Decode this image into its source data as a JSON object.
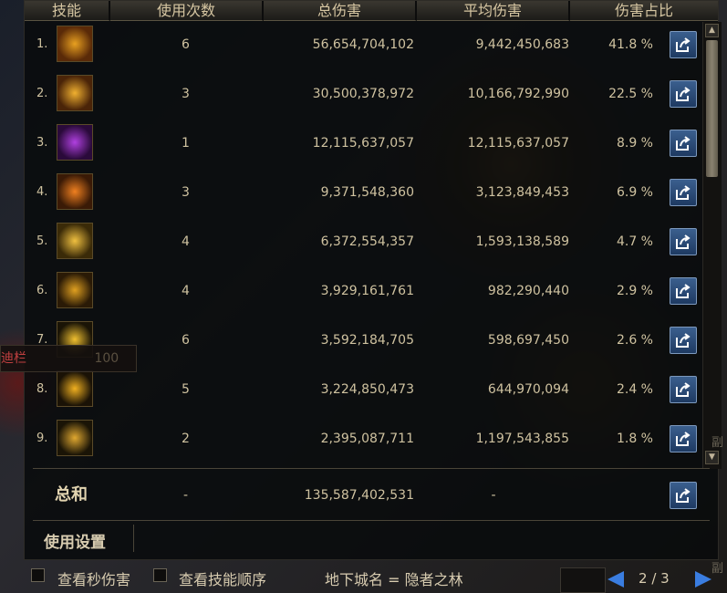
{
  "headers": [
    "技能",
    "使用次数",
    "总伤害",
    "平均伤害",
    "伤害占比"
  ],
  "rows": [
    {
      "rank": "1.",
      "count": "6",
      "total": "56,654,704,102",
      "avg": "9,442,450,683",
      "pct": "41.8 %",
      "icon": "skill-1-icon",
      "colors": [
        "#e8a020",
        "#5a2a08"
      ]
    },
    {
      "rank": "2.",
      "count": "3",
      "total": "30,500,378,972",
      "avg": "10,166,792,990",
      "pct": "22.5 %",
      "icon": "skill-2-icon",
      "colors": [
        "#f0b030",
        "#4a2408"
      ]
    },
    {
      "rank": "3.",
      "count": "1",
      "total": "12,115,637,057",
      "avg": "12,115,637,057",
      "pct": "8.9 %",
      "icon": "skill-3-icon",
      "colors": [
        "#b040e0",
        "#2a0a3a"
      ]
    },
    {
      "rank": "4.",
      "count": "3",
      "total": "9,371,548,360",
      "avg": "3,123,849,453",
      "pct": "6.9 %",
      "icon": "skill-4-icon",
      "colors": [
        "#f08020",
        "#3a1a06"
      ]
    },
    {
      "rank": "5.",
      "count": "4",
      "total": "6,372,554,357",
      "avg": "1,593,138,589",
      "pct": "4.7 %",
      "icon": "skill-5-icon",
      "colors": [
        "#f0c040",
        "#3a2a08"
      ]
    },
    {
      "rank": "6.",
      "count": "4",
      "total": "3,929,161,761",
      "avg": "982,290,440",
      "pct": "2.9 %",
      "icon": "skill-6-icon",
      "colors": [
        "#e0a020",
        "#2a1a06"
      ]
    },
    {
      "rank": "7.",
      "count": "6",
      "total": "3,592,184,705",
      "avg": "598,697,450",
      "pct": "2.6 %",
      "icon": "skill-7-icon",
      "colors": [
        "#f0c030",
        "#1a1406"
      ]
    },
    {
      "rank": "8.",
      "count": "5",
      "total": "3,224,850,473",
      "avg": "644,970,094",
      "pct": "2.4 %",
      "icon": "skill-8-icon",
      "colors": [
        "#f0b020",
        "#1a1206"
      ]
    },
    {
      "rank": "9.",
      "count": "2",
      "total": "2,395,087,711",
      "avg": "1,197,543,855",
      "pct": "1.8 %",
      "icon": "skill-9-icon",
      "colors": [
        "#e0a830",
        "#1a1406"
      ]
    }
  ],
  "summary": {
    "label": "总和",
    "count": "-",
    "total": "135,587,402,531",
    "avg": "-"
  },
  "settings_label": "使用设置",
  "footer": {
    "check1": "查看秒伤害",
    "check2": "查看技能顺序",
    "dungeon": "地下城名 = 隐者之林",
    "page_current": "2",
    "page_sep": "/",
    "page_total": "3"
  },
  "bg_labels": {
    "left": "迪栏",
    "left_num": "100",
    "right1": "副",
    "right2": "副"
  }
}
